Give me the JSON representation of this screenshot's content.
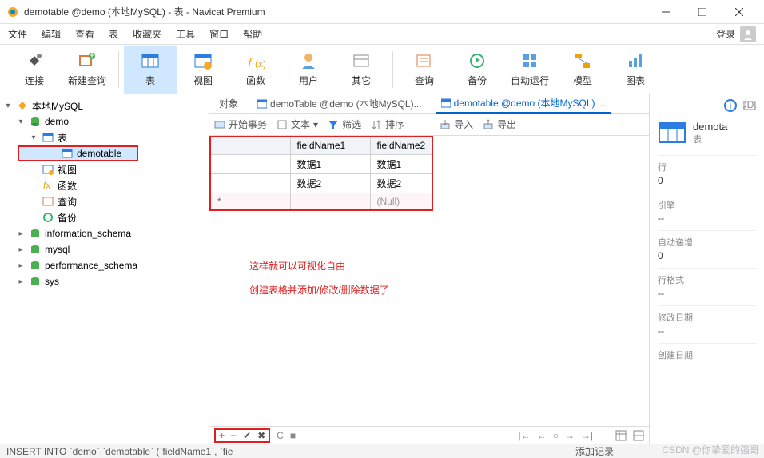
{
  "window": {
    "title": "demotable @demo (本地MySQL) - 表 - Navicat Premium"
  },
  "menu": {
    "items": [
      "文件",
      "编辑",
      "查看",
      "表",
      "收藏夹",
      "工具",
      "窗口",
      "帮助"
    ],
    "login": "登录"
  },
  "toolbar": {
    "connect": "连接",
    "newquery": "新建查询",
    "table": "表",
    "view": "视图",
    "function": "函数",
    "user": "用户",
    "other": "其它",
    "query": "查询",
    "backup": "备份",
    "autorun": "自动运行",
    "model": "模型",
    "chart": "图表"
  },
  "tree": {
    "root": "本地MySQL",
    "db": "demo",
    "tables_label": "表",
    "table_item": "demotable",
    "views": "视图",
    "functions": "函数",
    "queries": "查询",
    "backups": "备份",
    "info_schema": "information_schema",
    "mysql": "mysql",
    "perf_schema": "performance_schema",
    "sys": "sys"
  },
  "tabs": {
    "objects": "对象",
    "demoTable": "demoTable @demo (本地MySQL)...",
    "demotable": "demotable @demo (本地MySQL) ..."
  },
  "tabtools": {
    "begin_tx": "开始事务",
    "text": "文本",
    "filter": "筛选",
    "sort": "排序",
    "import": "导入",
    "export": "导出"
  },
  "grid": {
    "cols": [
      "fieldName1",
      "fieldName2"
    ],
    "rows": [
      [
        "数据1",
        "数据1"
      ],
      [
        "数据2",
        "数据2"
      ]
    ],
    "null_label": "(Null)",
    "new_marker": "*"
  },
  "annotation": {
    "line1": "这样就可以可视化自由",
    "line2": "创建表格并添加/修改/删除数据了"
  },
  "properties": {
    "name": "demota",
    "type": "表",
    "rows_label": "行",
    "rows_val": "0",
    "engine_label": "引擎",
    "engine_val": "--",
    "autoinc_label": "自动递增",
    "autoinc_val": "0",
    "rowfmt_label": "行格式",
    "rowfmt_val": "--",
    "modified_label": "修改日期",
    "modified_val": "--",
    "created_label": "创建日期"
  },
  "footer": {
    "add_record": "添加记录"
  },
  "status": {
    "sql": "INSERT INTO `demo`.`demotable` (`fieldName1`, `fie"
  },
  "watermark": "CSDN @你挚爱的强哥"
}
